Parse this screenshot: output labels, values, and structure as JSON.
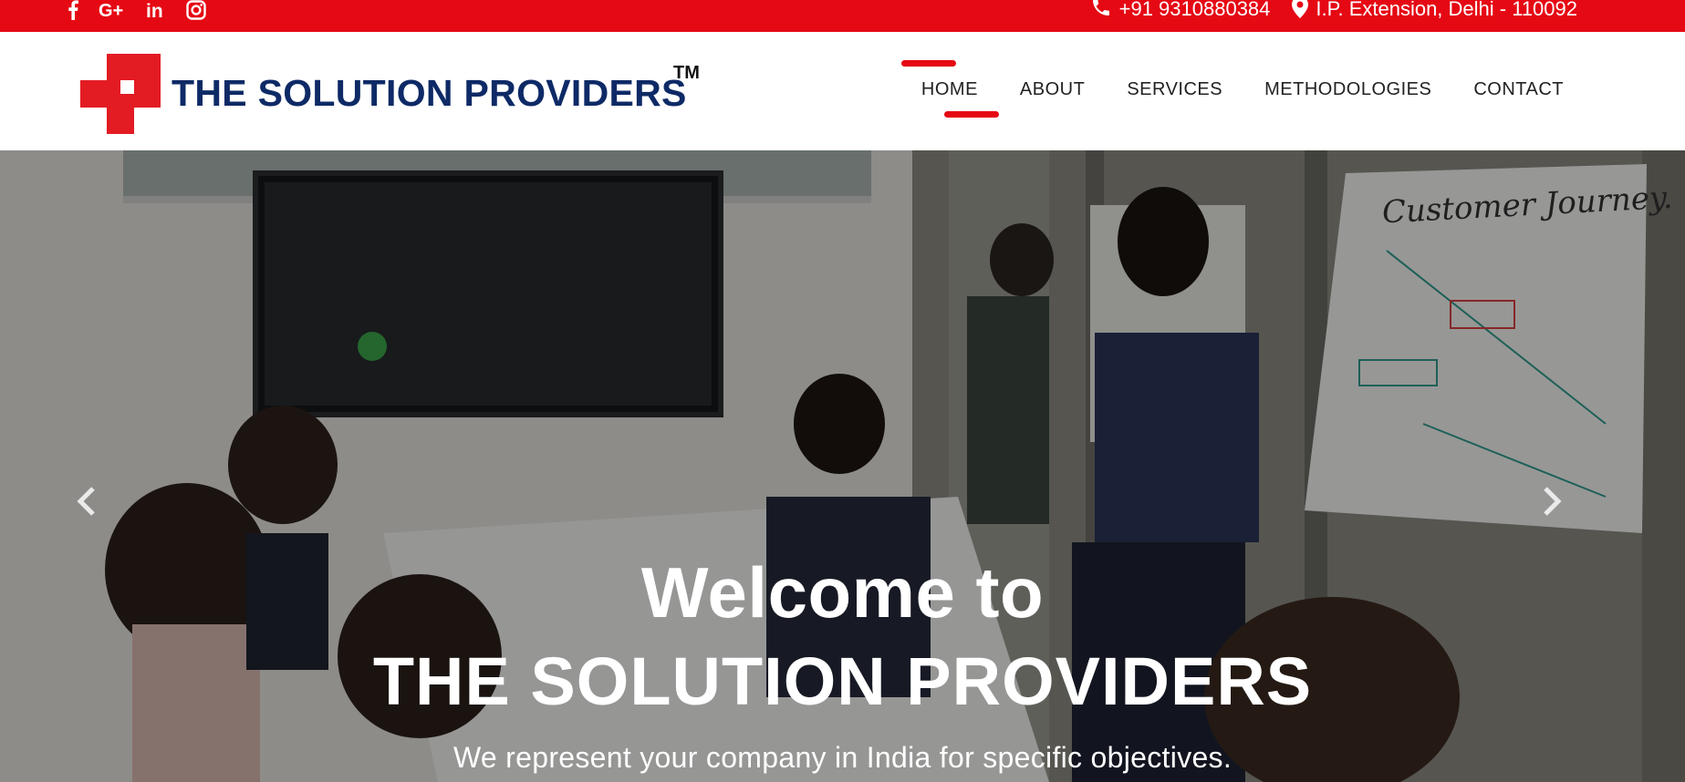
{
  "topbar": {
    "bg_color": "#e50914",
    "social": [
      {
        "name": "facebook-icon"
      },
      {
        "name": "google-plus-icon"
      },
      {
        "name": "linkedin-icon"
      },
      {
        "name": "instagram-icon"
      }
    ],
    "phone": "+91 9310880384",
    "address": "I.P. Extension, Delhi - 110092"
  },
  "header": {
    "logo_text": "THE SOLUTION PROVIDERS",
    "logo_tm": "TM",
    "brand_red": "#e31b23",
    "brand_navy": "#0e2a66",
    "nav": [
      {
        "label": "HOME",
        "active": true
      },
      {
        "label": "ABOUT",
        "active": false
      },
      {
        "label": "SERVICES",
        "active": false
      },
      {
        "label": "METHODOLOGIES",
        "active": false
      },
      {
        "label": "CONTACT",
        "active": false
      }
    ]
  },
  "hero": {
    "welcome": "Welcome to",
    "title": "THE SOLUTION PROVIDERS",
    "subtitle": "We represent your company in India for specific objectives.",
    "prev_icon": "chevron-left-icon",
    "next_icon": "chevron-right-icon",
    "whiteboard_title": "Customer Journey"
  }
}
